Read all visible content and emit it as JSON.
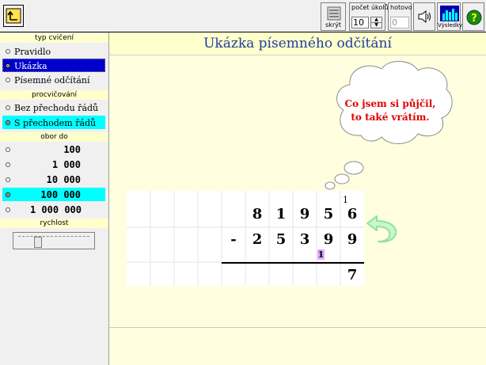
{
  "toolbar": {
    "hide_label": "skrýt",
    "count_title": "počet úkolů",
    "count_value": "10",
    "done_title": "hotovo",
    "done_value": "0",
    "results_label": "Výsledky"
  },
  "sidebar": {
    "type_header": "typ cvičení",
    "type_options": [
      "Pravidlo",
      "Ukázka",
      "Písemné odčítání"
    ],
    "type_selected": 1,
    "practice_header": "procvičování",
    "practice_options": [
      "Bez přechodu řádů",
      "S přechodem řádů"
    ],
    "practice_selected": 1,
    "range_header": "obor do",
    "range_options": [
      "100",
      "1 000",
      "10 000",
      "100 000",
      "1 000 000"
    ],
    "range_selected": 3,
    "speed_header": "rychlost",
    "speed_level": 0.25
  },
  "main": {
    "title": "Ukázka písemného odčítání",
    "bubble_line1": "Co jsem si půjčil,",
    "bubble_line2": "to také vrátím.",
    "minuend_digits": [
      "8",
      "1",
      "9",
      "5",
      "6"
    ],
    "carry_over_top": "1",
    "minus_sign": "-",
    "subtrahend_digits": [
      "2",
      "5",
      "3",
      "9",
      "9"
    ],
    "borrow_mark": "1",
    "result_digit": "7"
  },
  "colors": {
    "title_blue": "#1f3d9e",
    "bubble_red": "#e00000",
    "selected_blue": "#0000cc",
    "selected_cyan": "#00ffff",
    "arrow_green": "#8fe39a"
  }
}
